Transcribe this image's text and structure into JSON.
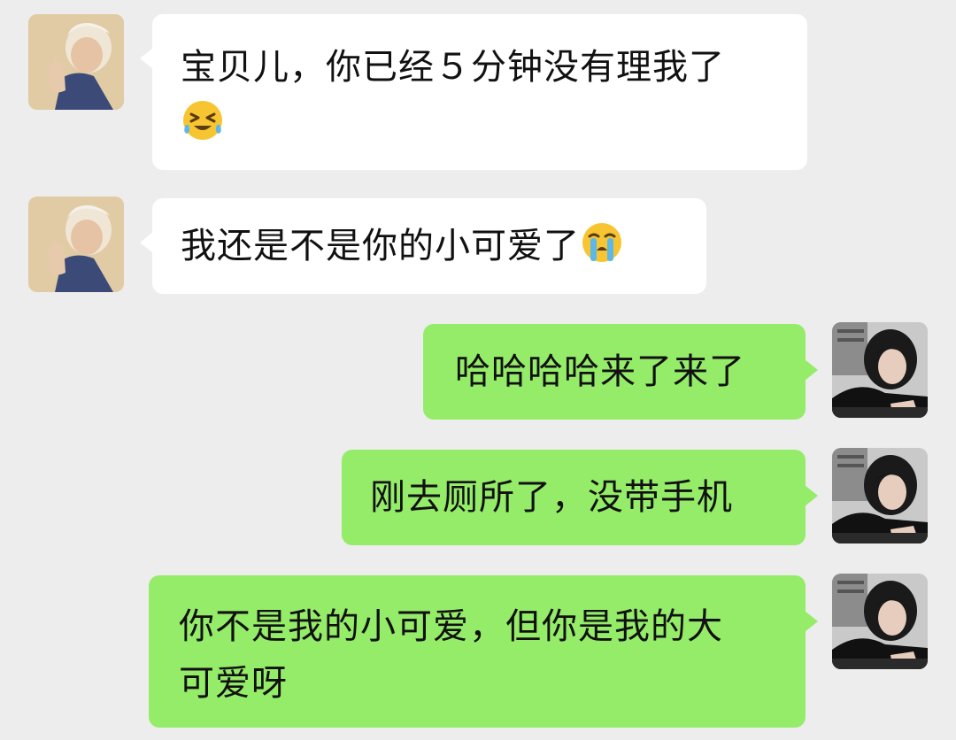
{
  "chat": {
    "messages": [
      {
        "side": "in",
        "lines": [
          "宝贝儿，你已经５分钟没有理我了"
        ],
        "emoji": "grinning-squinting-tears-emoji"
      },
      {
        "side": "in",
        "text": "我还是不是你的小可爱了",
        "emoji": "loudly-crying-emoji"
      },
      {
        "side": "out",
        "text": "哈哈哈哈来了来了"
      },
      {
        "side": "out",
        "text": "刚去厕所了，没带手机"
      },
      {
        "side": "out",
        "lines": [
          "你不是我的小可爱，但你是我的大",
          "可爱呀"
        ]
      }
    ]
  },
  "colors": {
    "background": "#ededed",
    "incoming_bubble": "#ffffff",
    "outgoing_bubble": "#95ec69"
  }
}
